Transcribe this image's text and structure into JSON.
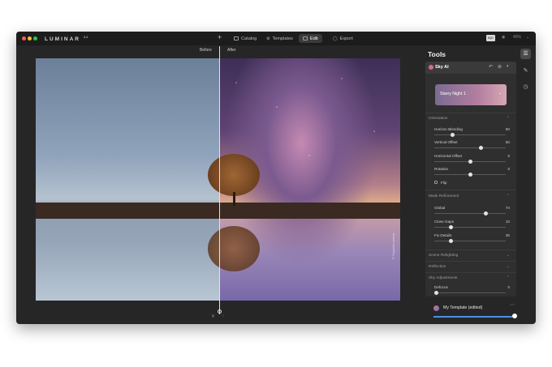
{
  "app": {
    "name": "LUMINAR",
    "version": "4.2"
  },
  "topbar": {
    "tabs": [
      {
        "label": "Catalog"
      },
      {
        "label": "Templates"
      },
      {
        "label": "Edit",
        "active": true
      },
      {
        "label": "Export"
      }
    ],
    "zoom": "45%",
    "compare_badge": "B|O"
  },
  "view": {
    "before_label": "Before",
    "after_label": "After",
    "watermark": "© Skylum/Luminar"
  },
  "tools": {
    "title": "Tools",
    "sky": {
      "name": "Sky AI",
      "preset": "Starry Night 1",
      "sections": {
        "orientation": "Orientation",
        "mask_refinement": "Mask Refinement",
        "scene_relighting": "Scene Relighting",
        "reflection": "Reflection",
        "sky_adjustments": "Sky Adjustments"
      },
      "sliders": {
        "horizon_blending": {
          "label": "Horizon Blending",
          "value": "50",
          "level": 0.25
        },
        "vertical_offset": {
          "label": "Vertical Offset",
          "value": "50",
          "level": 0.65
        },
        "horizontal_offset": {
          "label": "Horizontal Offset",
          "value": "0",
          "level": 0.5
        },
        "rotation": {
          "label": "Rotation",
          "value": "0",
          "level": 0.5
        },
        "global": {
          "label": "Global",
          "value": "74",
          "level": 0.7
        },
        "close_gaps": {
          "label": "Close Gaps",
          "value": "10",
          "level": 0.22
        },
        "fix_details": {
          "label": "Fix Details",
          "value": "30",
          "level": 0.22
        },
        "defocus": {
          "label": "Defocus",
          "value": "0",
          "level": 0.0
        }
      },
      "flip_label": "Flip"
    }
  },
  "template": {
    "name": "My Template (edited)",
    "amount": 1.0
  },
  "colors": {
    "accent": "#4b8ee8",
    "sky_badge": "#d8669e",
    "window_bg": "#262626"
  }
}
